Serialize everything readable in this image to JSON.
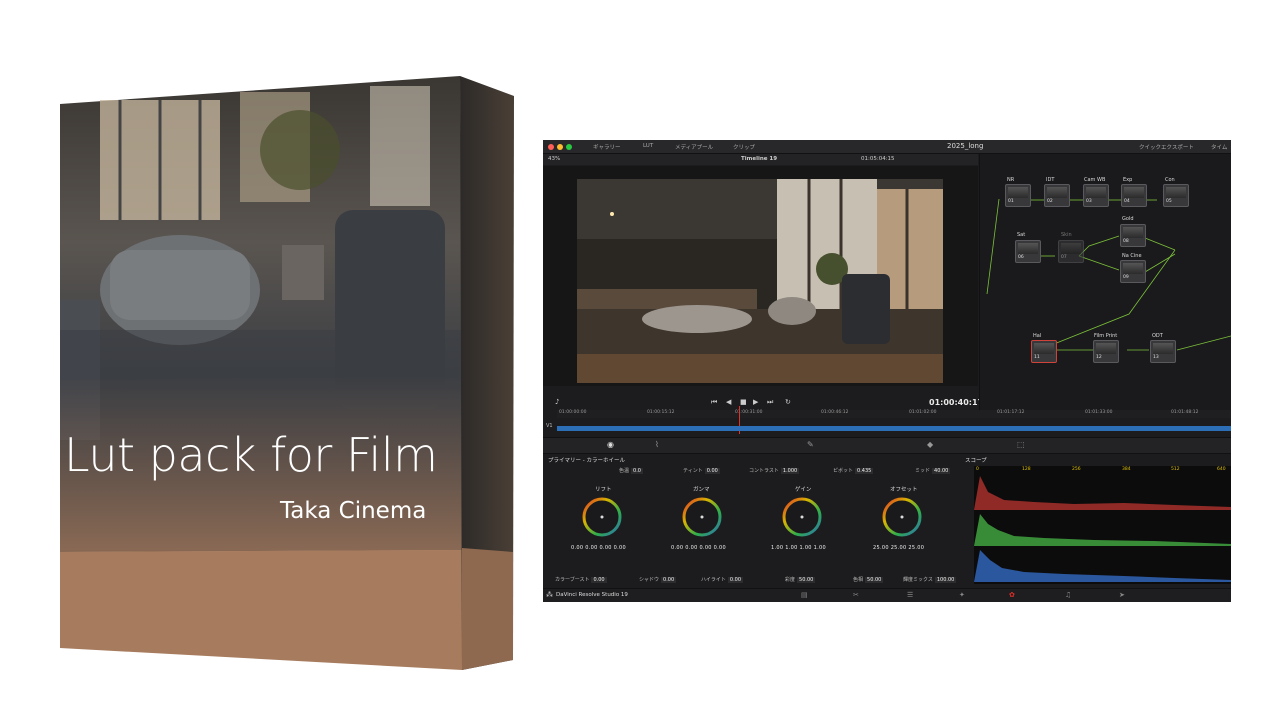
{
  "box": {
    "title": "Lut pack for Film",
    "subtitle": "Taka Cinema"
  },
  "colors": {
    "box_bottom": "#a77b5d",
    "timeline_blue": "#2d6fb7",
    "playhead": "#e0302a",
    "scope_label": "#e0c200"
  },
  "app": {
    "project_title": "2025_long",
    "toolbar_items": [
      "ギャラリー",
      "LUT",
      "メディアプール",
      "クリップ"
    ],
    "toolbar_right": [
      "クイックエクスポート",
      "タイム"
    ],
    "zoom": "43%",
    "timeline_name": "Timeline 19",
    "source_timecode": "01:05:04:15",
    "current_timecode": "01:00:40:17",
    "ruler_ticks": [
      "01:00:00:00",
      "01:00:15:12",
      "01:00:31:00",
      "01:00:46:12",
      "01:01:02:00",
      "01:01:17:12",
      "01:01:33:00",
      "01:01:48:12",
      "01:02:04:00"
    ],
    "track_label": "V1",
    "footer_title": "DaVinci Resolve Studio 19"
  },
  "nodes": [
    {
      "label": "NR",
      "num": "01"
    },
    {
      "label": "IDT",
      "num": "02"
    },
    {
      "label": "Cam WB",
      "num": "03"
    },
    {
      "label": "Exp",
      "num": "04"
    },
    {
      "label": "Con",
      "num": "05"
    },
    {
      "label": "Sat",
      "num": "06"
    },
    {
      "label": "Skin",
      "num": "07"
    },
    {
      "label": "Gold",
      "num": "08"
    },
    {
      "label": "Na Cine",
      "num": "09"
    },
    {
      "label": "Hal",
      "num": "11"
    },
    {
      "label": "Film Print",
      "num": "12"
    },
    {
      "label": "ODT",
      "num": "13"
    }
  ],
  "color_panel": {
    "title": "プライマリー - カラーホイール",
    "scope_title": "スコープ",
    "top_params": [
      {
        "label": "色温",
        "value": "0.0"
      },
      {
        "label": "ティント",
        "value": "0.00"
      },
      {
        "label": "コントラスト",
        "value": "1.000"
      },
      {
        "label": "ピボット",
        "value": "0.435"
      },
      {
        "label": "ミッド",
        "value": "40.00"
      }
    ],
    "wheels": [
      {
        "label": "リフト",
        "values": "0.00  0.00  0.00  0.00"
      },
      {
        "label": "ガンマ",
        "values": "0.00  0.00  0.00  0.00"
      },
      {
        "label": "ゲイン",
        "values": "1.00  1.00  1.00  1.00"
      },
      {
        "label": "オフセット",
        "values": "25.00  25.00  25.00"
      }
    ],
    "bottom_params": [
      {
        "label": "カラーブースト",
        "value": "0.00"
      },
      {
        "label": "シャドウ",
        "value": "0.00"
      },
      {
        "label": "ハイライト",
        "value": "0.00"
      },
      {
        "label": "彩度",
        "value": "50.00"
      },
      {
        "label": "色相",
        "value": "50.00"
      },
      {
        "label": "輝度ミックス",
        "value": "100.00"
      }
    ],
    "scope_ticks": [
      "0",
      "128",
      "256",
      "384",
      "512",
      "640"
    ]
  }
}
